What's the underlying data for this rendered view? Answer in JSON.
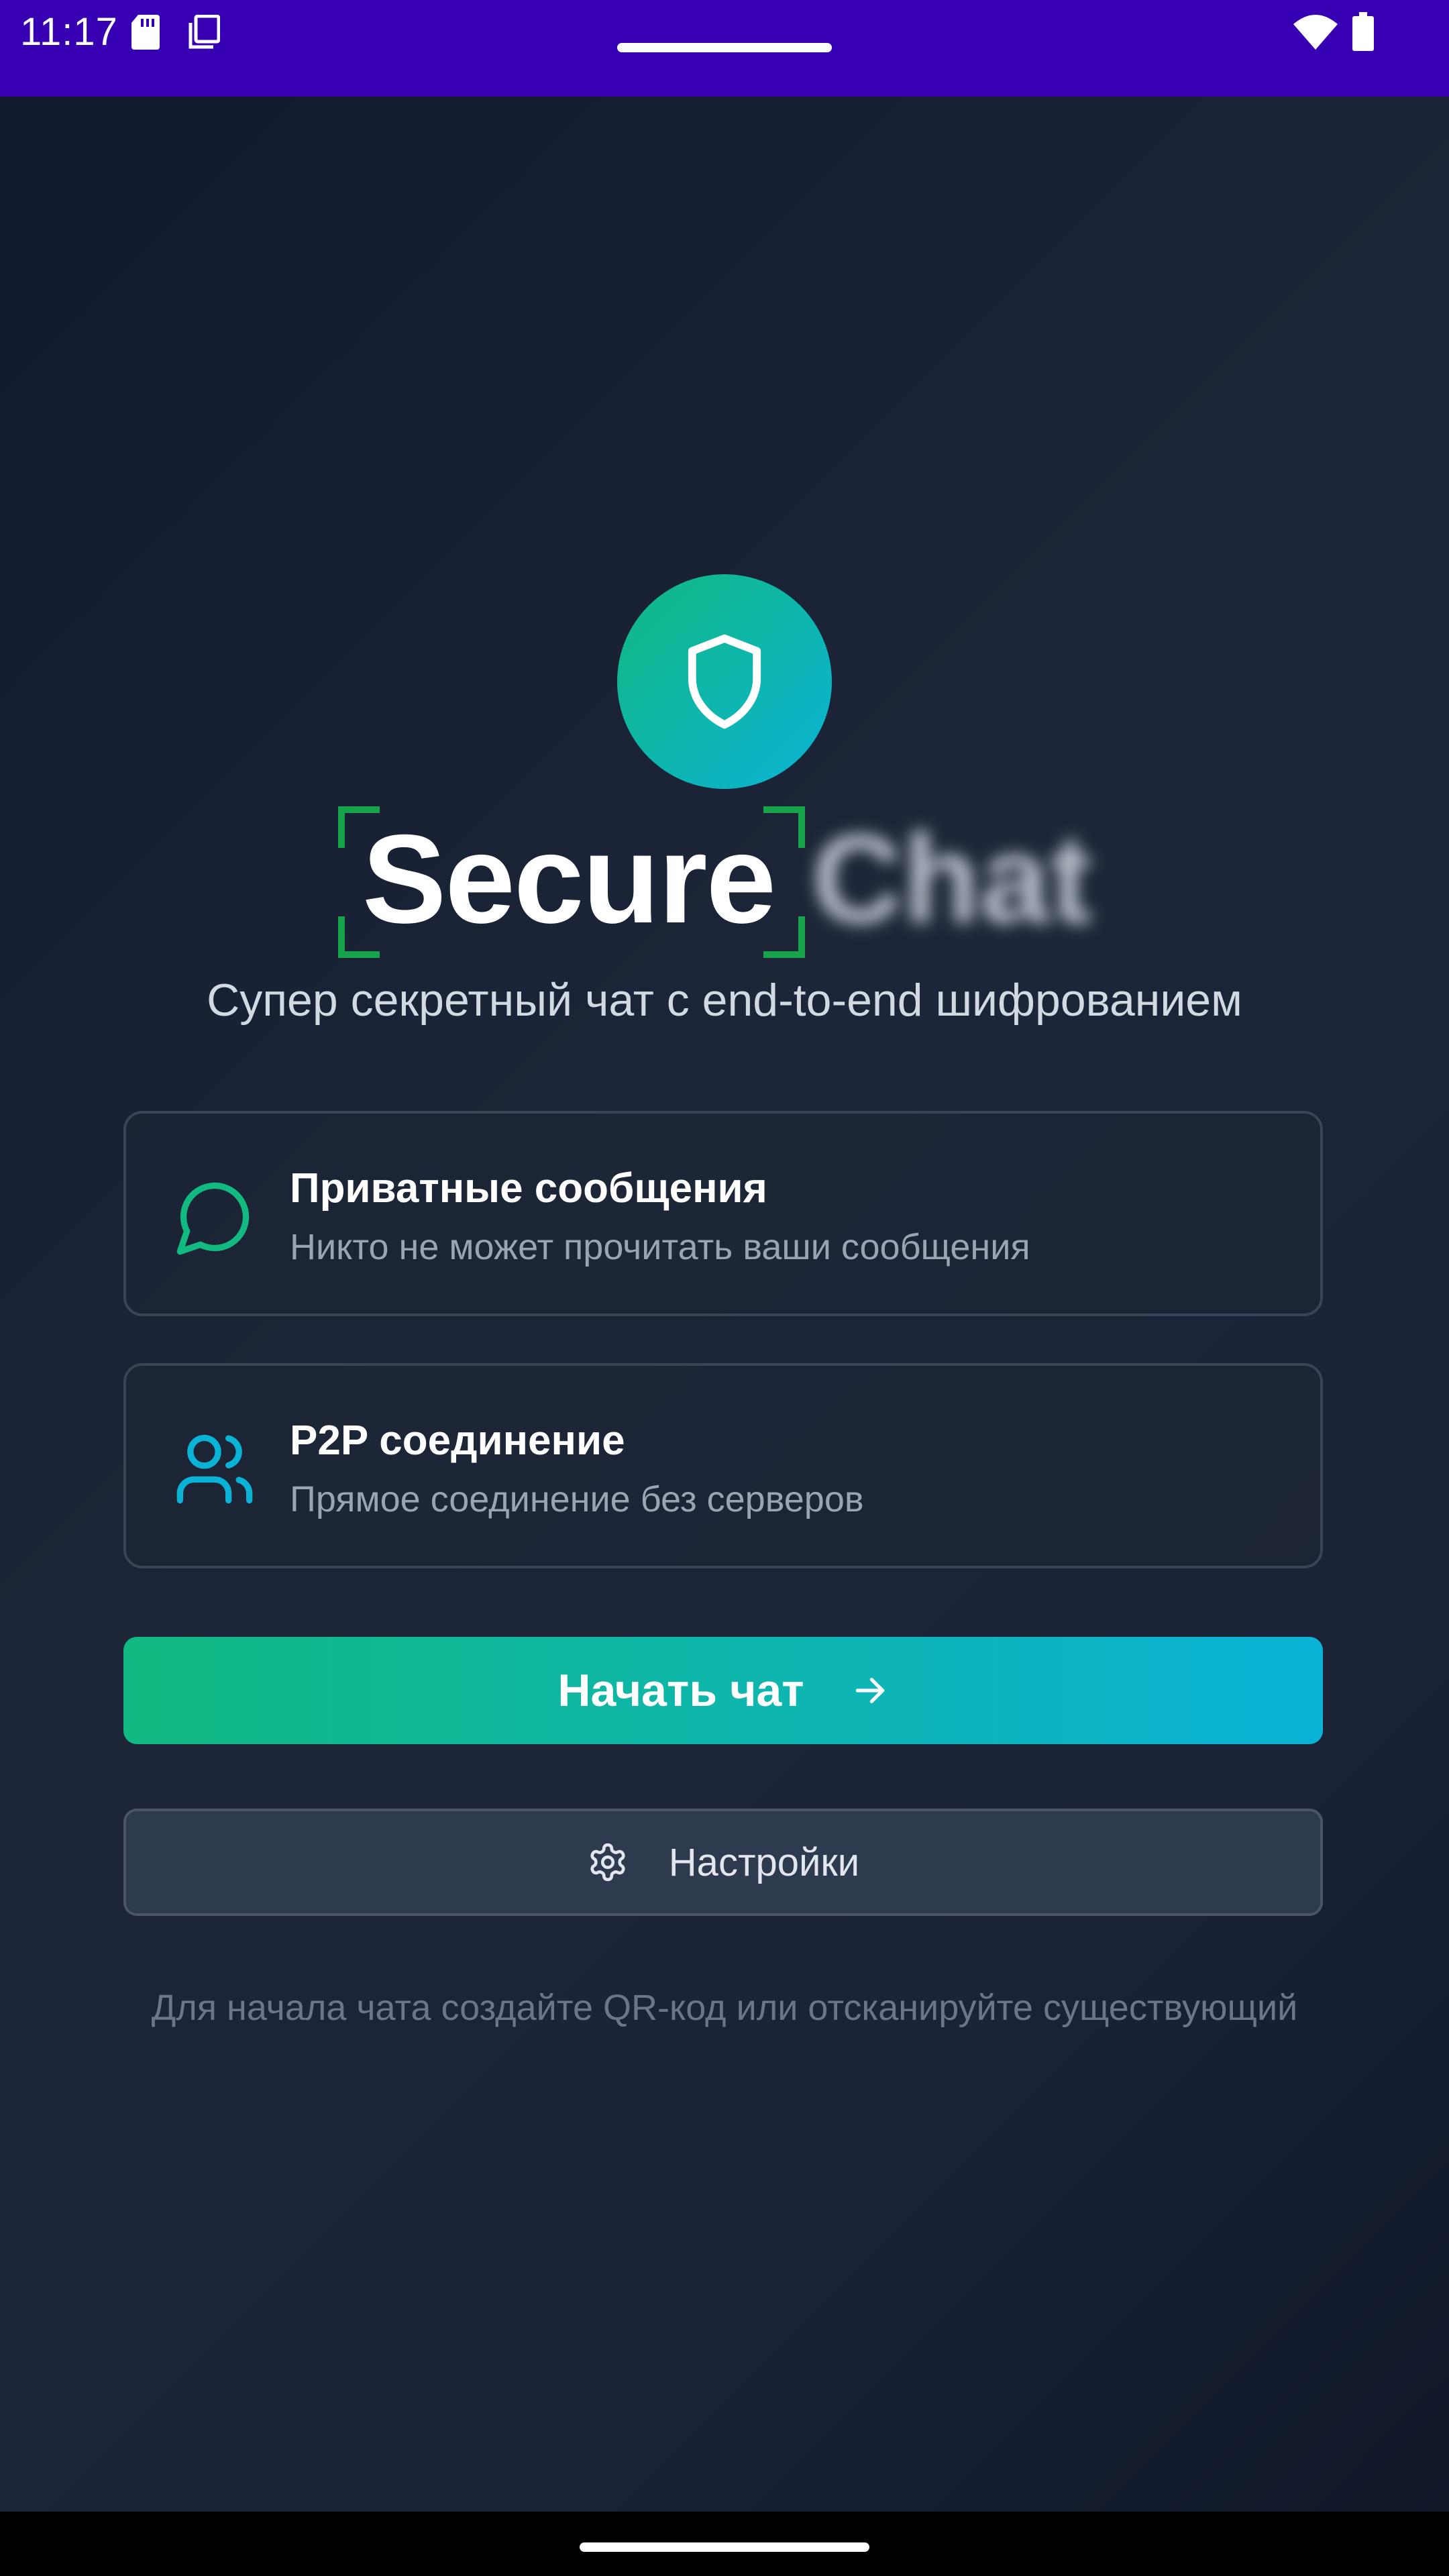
{
  "status_bar": {
    "time": "11:17",
    "icons": [
      "sd-card-icon",
      "copy-icon",
      "wifi-icon",
      "battery-icon"
    ],
    "background": "#3700b3"
  },
  "app": {
    "logo_icon": "shield-icon",
    "title_primary": "Secure",
    "title_secondary": "Chat",
    "subtitle": "Супер секретный чат с end-to-end шифрованием"
  },
  "features": [
    {
      "icon": "message-circle-icon",
      "title": "Приватные сообщения",
      "description": "Никто не может прочитать ваши сообщения"
    },
    {
      "icon": "users-icon",
      "title": "P2P соединение",
      "description": "Прямое соединение без серверов"
    }
  ],
  "actions": {
    "start_chat_label": "Начать чат",
    "start_chat_icon": "arrow-right-icon",
    "settings_label": "Настройки",
    "settings_icon": "gear-icon"
  },
  "hint": "Для начала чата создайте QR-код или отсканируйте существующий",
  "colors": {
    "accent_green": "#12b981",
    "accent_cyan": "#0ab3d6",
    "bracket_green": "#16a34a"
  }
}
